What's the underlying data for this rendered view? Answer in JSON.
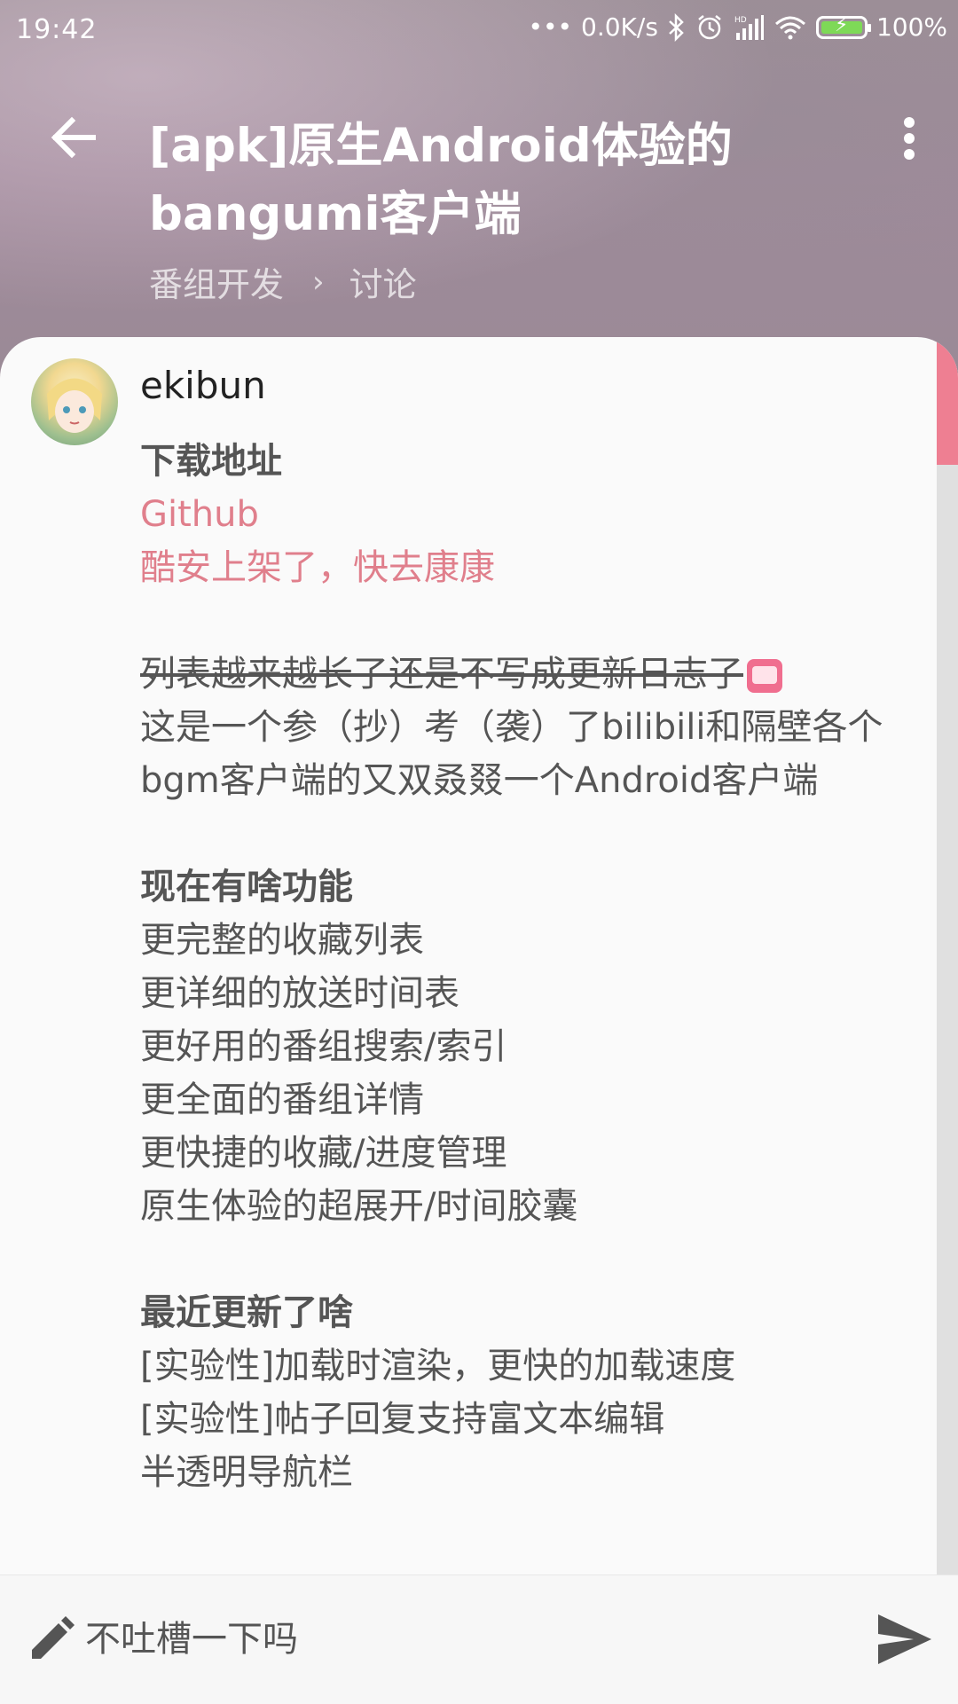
{
  "status_bar": {
    "time": "19:42",
    "network_speed": "0.0K/s",
    "battery": "100%",
    "icons": [
      "bluetooth-icon",
      "alarm-icon",
      "hd-signal-icon",
      "wifi-icon",
      "battery-charging-icon"
    ]
  },
  "toolbar": {
    "title": "[apk]原生Android体验的bangumi客户端",
    "back_icon": "arrow-back-icon",
    "more_icon": "more-vert-icon"
  },
  "breadcrumb": {
    "items": [
      "番组开发",
      "讨论"
    ],
    "separator": "›"
  },
  "post": {
    "author": "ekibun",
    "lines": [
      "下载地址",
      "Github",
      "酷安上架了，快去康康",
      "",
      "列表越来越长了还是不写成更新日志了",
      "这是一个参（抄）考（袭）了bilibili和隔壁各个",
      "bgm客户端的又双叒叕一个Android客户端",
      "",
      "现在有啥功能",
      "更完整的收藏列表",
      "更详细的放送时间表",
      "更好用的番组搜索/索引",
      "更全面的番组详情",
      "更快捷的收藏/进度管理",
      "原生体验的超展开/时间胶囊",
      "",
      "最近更新了啥",
      "[实验性]加载时渲染，更快的加载速度",
      "[实验性]帖子回复支持富文本编辑",
      "半透明导航栏"
    ]
  },
  "reply_bar": {
    "placeholder": "不吐槽一下吗",
    "edit_icon": "pencil-icon",
    "send_icon": "send-icon"
  },
  "colors": {
    "accent": "#e07f8c",
    "scroll_thumb": "#ee7f92",
    "text": "#555555"
  }
}
